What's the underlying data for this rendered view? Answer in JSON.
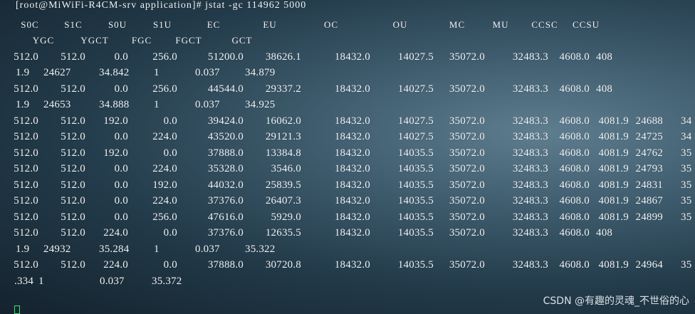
{
  "terminal": {
    "prompt": "[root@MiWiFi-R4CM-srv application]# jstat -gc 114962 5000",
    "header1": [
      "S0C",
      "S1C",
      "S0U",
      "S1U",
      "EC",
      "EU",
      "OC",
      "OU",
      "MC",
      "MU",
      "CCSC",
      "CCSU"
    ],
    "header2": [
      "YGC",
      "YGCT",
      "FGC",
      "FGCT",
      "GCT"
    ],
    "rows": [
      [
        "512.0",
        "512.0",
        "0.0",
        "256.0",
        "51200.0",
        "38626.1",
        "18432.0",
        "14027.5",
        "35072.0",
        "32483.3",
        "4608.0",
        "408"
      ],
      [
        "1.9",
        "24627",
        "34.842",
        "1",
        "0.037",
        "34.879"
      ],
      [
        "512.0",
        "512.0",
        "0.0",
        "256.0",
        "44544.0",
        "29337.2",
        "18432.0",
        "14027.5",
        "35072.0",
        "32483.3",
        "4608.0",
        "408"
      ],
      [
        "1.9",
        "24653",
        "34.888",
        "1",
        "0.037",
        "34.925"
      ],
      [
        "512.0",
        "512.0",
        "192.0",
        "0.0",
        "39424.0",
        "16062.0",
        "18432.0",
        "14027.5",
        "35072.0",
        "32483.3",
        "4608.0",
        "4081.9",
        "24688",
        "34"
      ],
      [
        "512.0",
        "512.0",
        "0.0",
        "224.0",
        "43520.0",
        "29121.3",
        "18432.0",
        "14027.5",
        "35072.0",
        "32483.3",
        "4608.0",
        "4081.9",
        "24725",
        "34"
      ],
      [
        "512.0",
        "512.0",
        "192.0",
        "0.0",
        "37888.0",
        "13384.8",
        "18432.0",
        "14035.5",
        "35072.0",
        "32483.3",
        "4608.0",
        "4081.9",
        "24762",
        "35"
      ],
      [
        "512.0",
        "512.0",
        "0.0",
        "224.0",
        "35328.0",
        "3546.0",
        "18432.0",
        "14035.5",
        "35072.0",
        "32483.3",
        "4608.0",
        "4081.9",
        "24793",
        "35"
      ],
      [
        "512.0",
        "512.0",
        "0.0",
        "192.0",
        "44032.0",
        "25839.5",
        "18432.0",
        "14035.5",
        "35072.0",
        "32483.3",
        "4608.0",
        "4081.9",
        "24831",
        "35"
      ],
      [
        "512.0",
        "512.0",
        "0.0",
        "224.0",
        "37376.0",
        "26407.3",
        "18432.0",
        "14035.5",
        "35072.0",
        "32483.3",
        "4608.0",
        "4081.9",
        "24867",
        "35"
      ],
      [
        "512.0",
        "512.0",
        "0.0",
        "256.0",
        "47616.0",
        "5929.0",
        "18432.0",
        "14035.5",
        "35072.0",
        "32483.3",
        "4608.0",
        "4081.9",
        "24899",
        "35"
      ],
      [
        "512.0",
        "512.0",
        "224.0",
        "0.0",
        "37376.0",
        "12635.5",
        "18432.0",
        "14035.5",
        "35072.0",
        "32483.3",
        "4608.0",
        "408"
      ],
      [
        "1.9",
        "24932",
        "35.284",
        "1",
        "0.037",
        "35.322"
      ],
      [
        "512.0",
        "512.0",
        "224.0",
        "0.0",
        "37888.0",
        "30720.8",
        "18432.0",
        "14035.5",
        "35072.0",
        "32483.3",
        "4608.0",
        "4081.9",
        "24964",
        "35"
      ],
      [
        ".334",
        "1",
        "0.037",
        "35.372"
      ]
    ],
    "cursor_color": "#3fe06a"
  },
  "watermark": "CSDN @有趣的灵魂_不世俗的心"
}
